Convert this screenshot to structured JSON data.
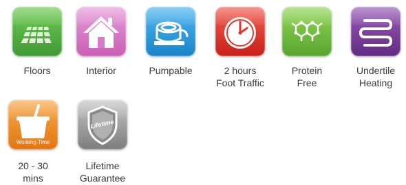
{
  "features": [
    {
      "name": "floors",
      "label_lines": [
        "Floors"
      ],
      "icon": "floor-tiles-icon",
      "color": "#5cb547"
    },
    {
      "name": "interior",
      "label_lines": [
        "Interior"
      ],
      "icon": "house-icon",
      "color": "#d77cc6"
    },
    {
      "name": "pumpable",
      "label_lines": [
        "Pumpable"
      ],
      "icon": "hose-reel-icon",
      "color": "#2b9ee0"
    },
    {
      "name": "foot-traffic",
      "label_lines": [
        "2 hours",
        "Foot Traffic"
      ],
      "icon": "clock-icon",
      "color": "#e5332a"
    },
    {
      "name": "protein-free",
      "label_lines": [
        "Protein",
        "Free"
      ],
      "icon": "molecule-icon",
      "color": "#7cc242"
    },
    {
      "name": "undertile-heating",
      "label_lines": [
        "Undertile",
        "Heating"
      ],
      "icon": "heating-coil-icon",
      "color": "#7b3c9c"
    },
    {
      "name": "working-time",
      "label_lines": [
        "20 - 30",
        "mins"
      ],
      "icon": "bucket-icon",
      "color": "#f08a22",
      "badge_text": "Working Time"
    },
    {
      "name": "lifetime-guarantee",
      "label_lines": [
        "Lifetime",
        "Guarantee"
      ],
      "icon": "shield-icon",
      "color": "#9a9a9a",
      "badge_text": "Lifetime"
    }
  ]
}
